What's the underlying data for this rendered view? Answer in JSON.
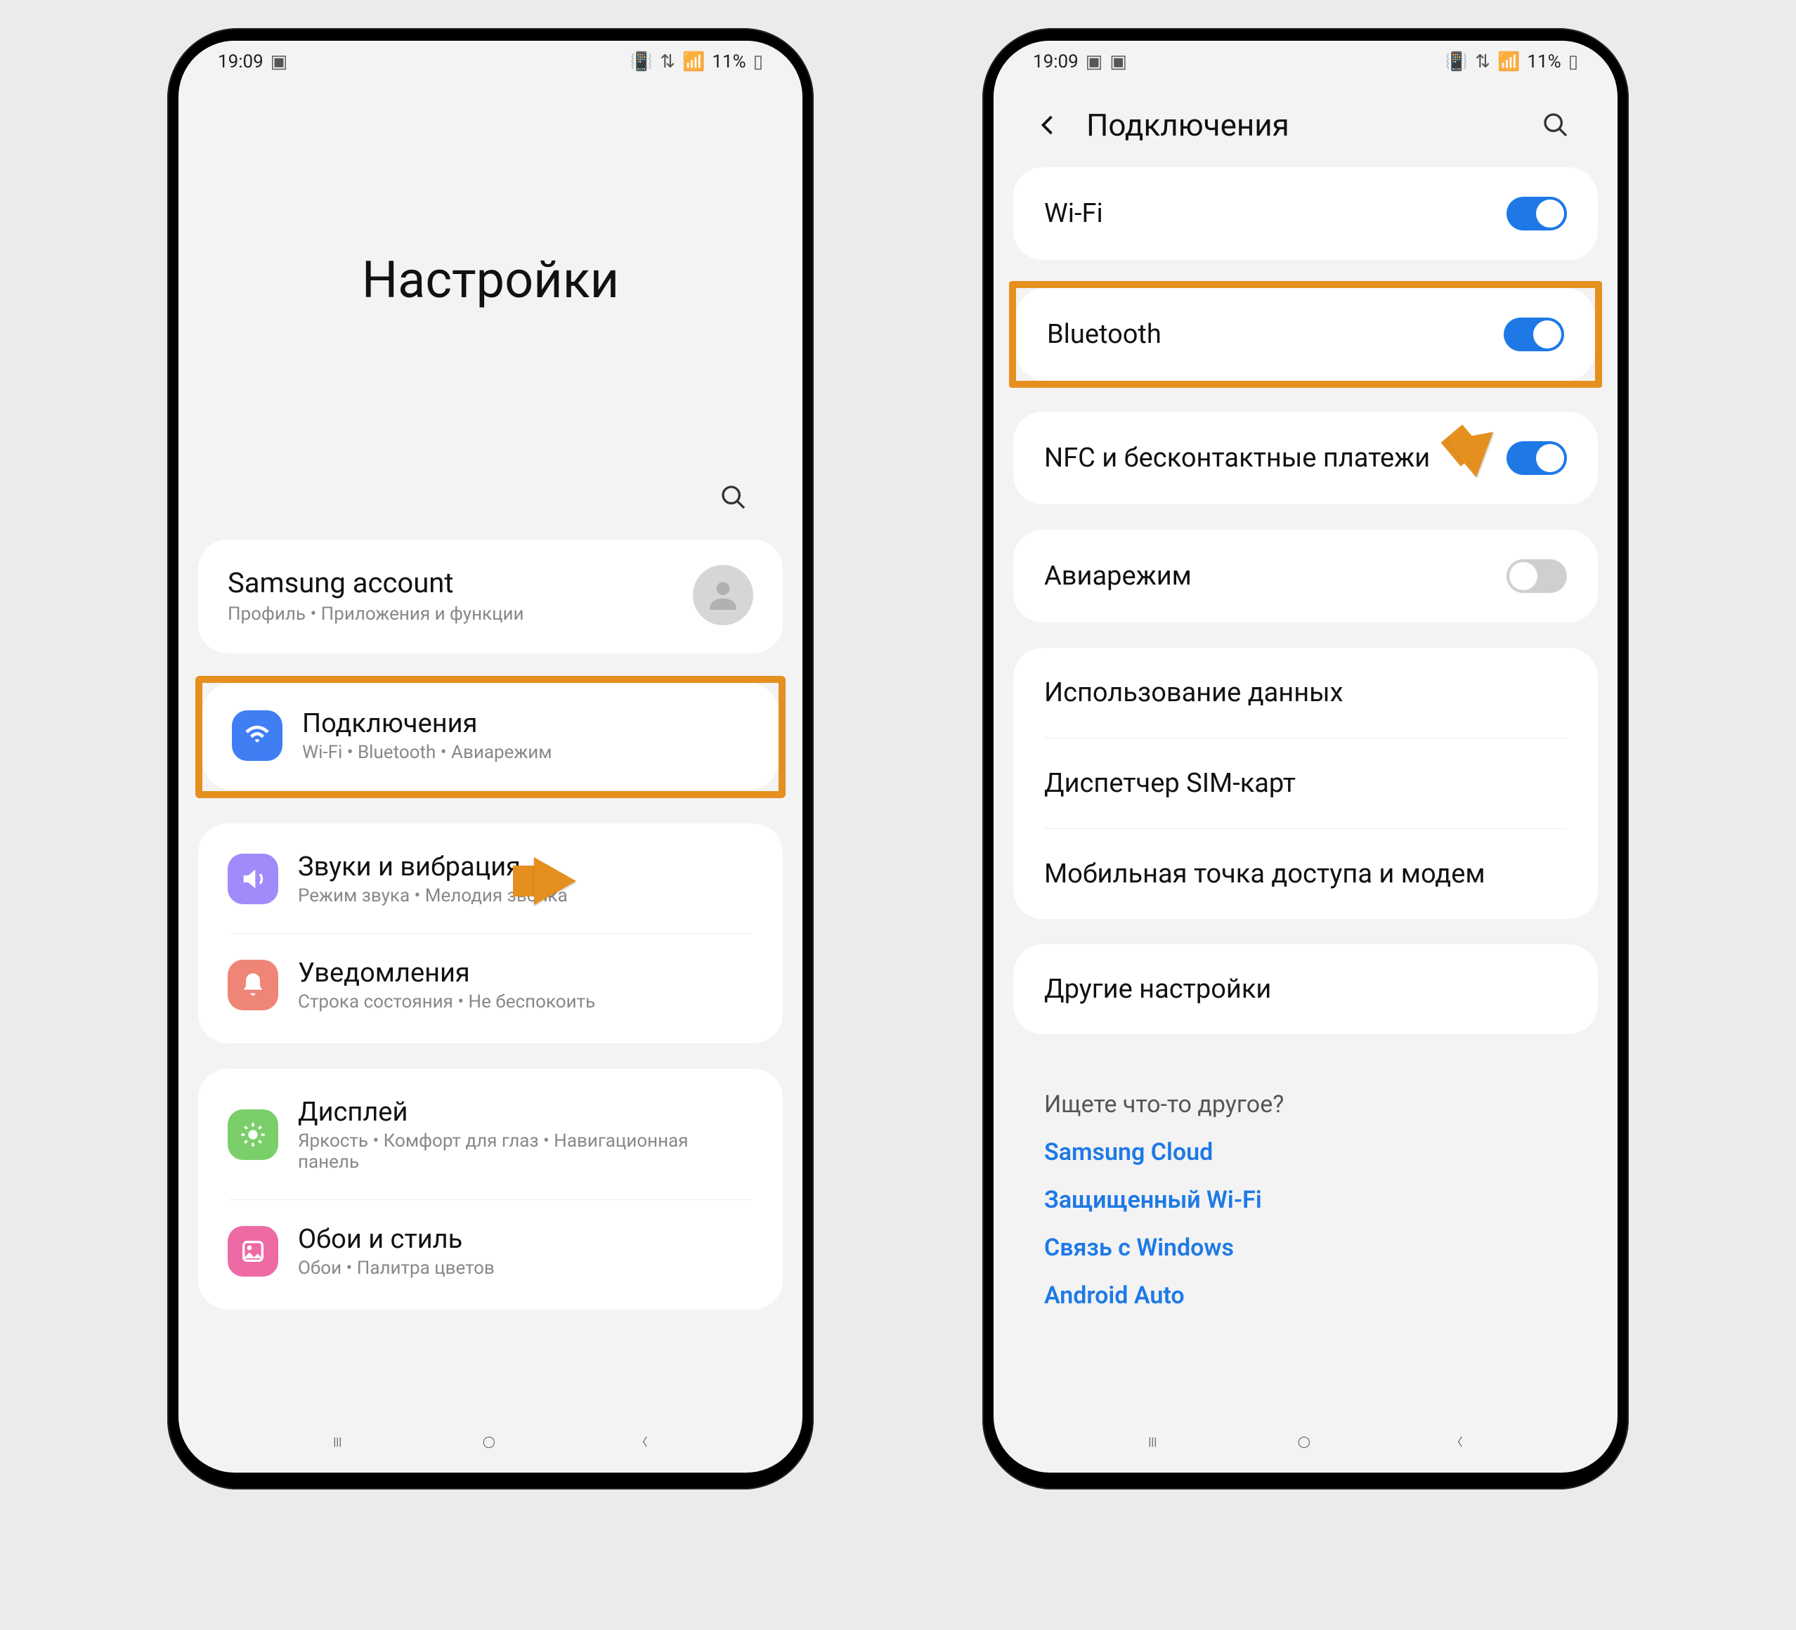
{
  "statusbar": {
    "time": "19:09",
    "battery_pct": "11%"
  },
  "screen1": {
    "title": "Настройки",
    "account": {
      "title": "Samsung account",
      "subtitle": "Профиль • Приложения и функции"
    },
    "rows": [
      {
        "title": "Подключения",
        "subtitle": "Wi-Fi • Bluetooth • Авиарежим"
      },
      {
        "title": "Звуки и вибрация",
        "subtitle": "Режим звука • Мелодия звонка"
      },
      {
        "title": "Уведомления",
        "subtitle": "Строка состояния • Не беспокоить"
      },
      {
        "title": "Дисплей",
        "subtitle": "Яркость • Комфорт для глаз • Навигационная панель"
      },
      {
        "title": "Обои и стиль",
        "subtitle": "Обои • Палитра цветов"
      }
    ]
  },
  "screen2": {
    "header": "Подключения",
    "toggles": [
      {
        "label": "Wi-Fi",
        "on": true
      },
      {
        "label": "Bluetooth",
        "on": true
      },
      {
        "label": "NFC и бесконтактные платежи",
        "on": true
      },
      {
        "label": "Авиарежим",
        "on": false
      }
    ],
    "items": [
      "Использование данных",
      "Диспетчер SIM-карт",
      "Мобильная точка доступа и модем",
      "Другие настройки"
    ],
    "other": {
      "heading": "Ищете что-то другое?",
      "links": [
        "Samsung Cloud",
        "Защищенный Wi-Fi",
        "Связь с Windows",
        "Android Auto"
      ]
    }
  }
}
